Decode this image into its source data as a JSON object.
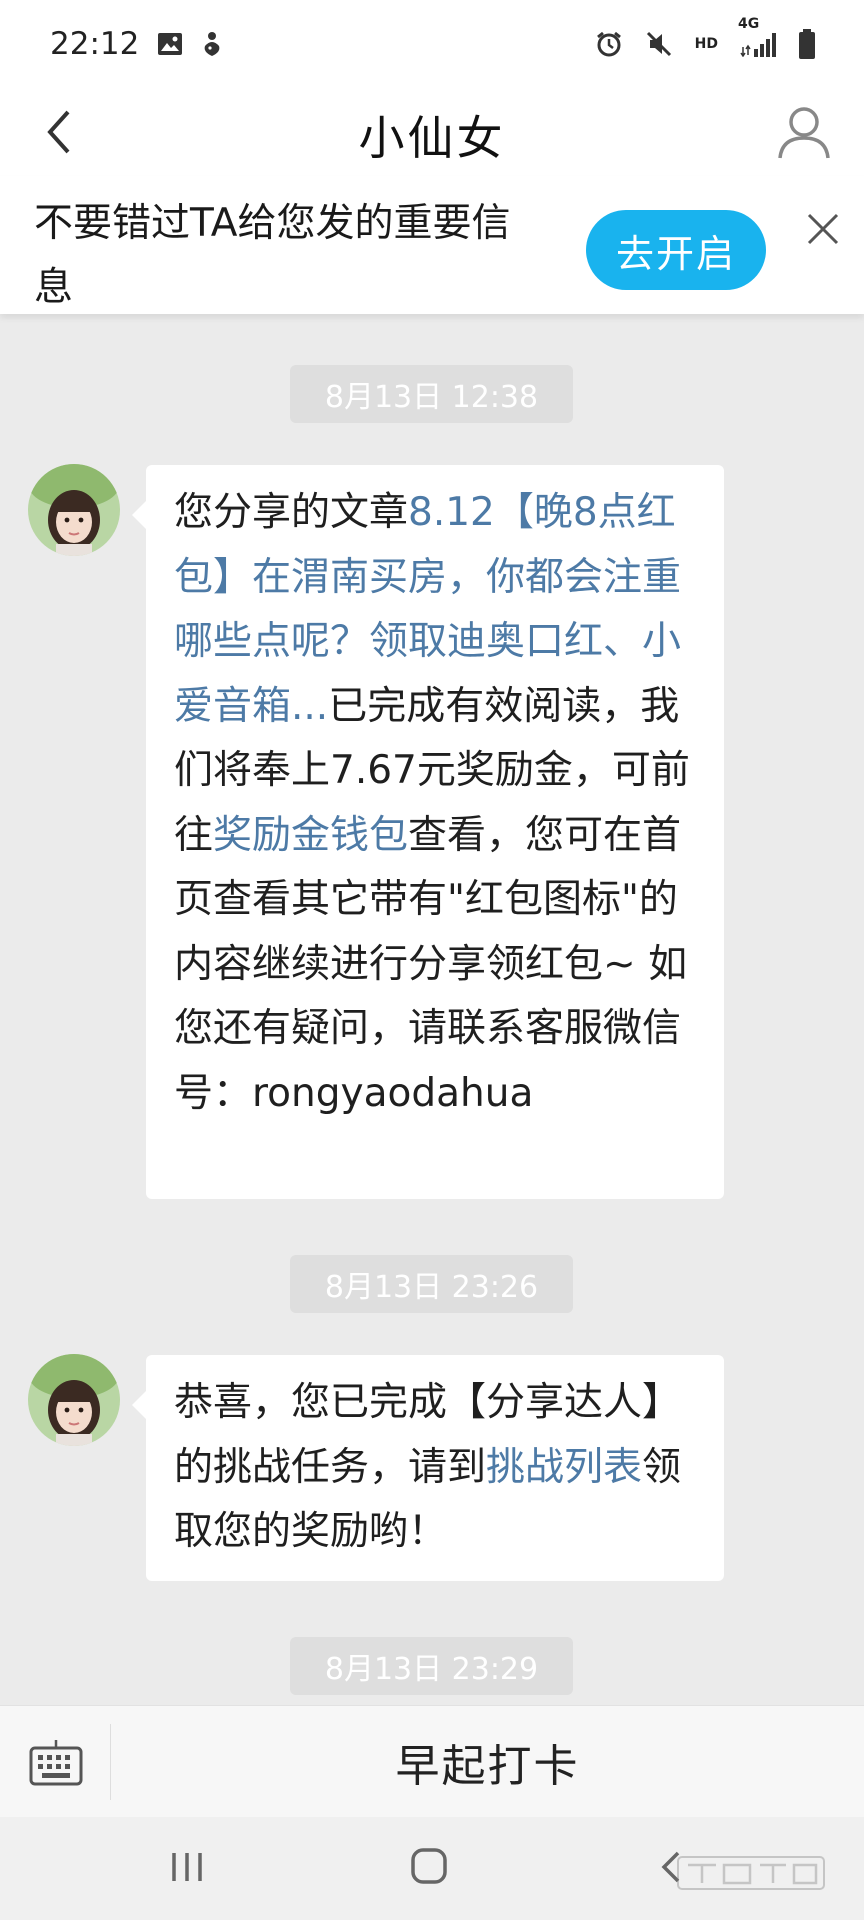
{
  "status_bar": {
    "time": "22:12",
    "icons": [
      "image-icon",
      "notification-icon",
      "alarm-icon",
      "mute-icon",
      "hd-icon",
      "4g-signal-icon",
      "battery-icon"
    ],
    "hd_label": "HD",
    "network_label": "4G"
  },
  "header": {
    "title": "小仙女",
    "back_icon": "chevron-left-icon",
    "profile_icon": "user-icon"
  },
  "banner": {
    "text": "不要错过TA给您发的重要信息",
    "button": "去开启",
    "close_icon": "close-icon"
  },
  "messages": [
    {
      "timestamp": "8月13日 12:38",
      "parts": [
        {
          "text": "您分享的文章",
          "link": false
        },
        {
          "text": "8.12【晚8点红包】在渭南买房，你都会注重哪些点呢？领取迪奥口红、小爱音箱...",
          "link": true
        },
        {
          "text": "已完成有效阅读，我们将奉上7.67元奖励金，可前往",
          "link": false
        },
        {
          "text": "奖励金钱包",
          "link": true
        },
        {
          "text": "查看，您可在首页查看其它带有\"红包图标\"的内容继续进行分享领红包~ 如您还有疑问，请联系客服微信号：rongyaodahua",
          "link": false
        }
      ]
    },
    {
      "timestamp": "8月13日 23:26",
      "parts": [
        {
          "text": "恭喜，您已完成【分享达人】的挑战任务，请到",
          "link": false
        },
        {
          "text": "挑战列表",
          "link": true
        },
        {
          "text": "领取您的奖励哟！",
          "link": false
        }
      ]
    },
    {
      "timestamp": "8月13日 23:29"
    }
  ],
  "input_bar": {
    "keyboard_icon": "keyboard-icon",
    "menu_label": "早起打卡"
  },
  "nav_bar": {
    "icons": [
      "recent-apps-icon",
      "home-icon",
      "back-icon"
    ]
  },
  "colors": {
    "accent": "#19b3ee",
    "link": "#4d7aa6",
    "background": "#ebebeb"
  }
}
